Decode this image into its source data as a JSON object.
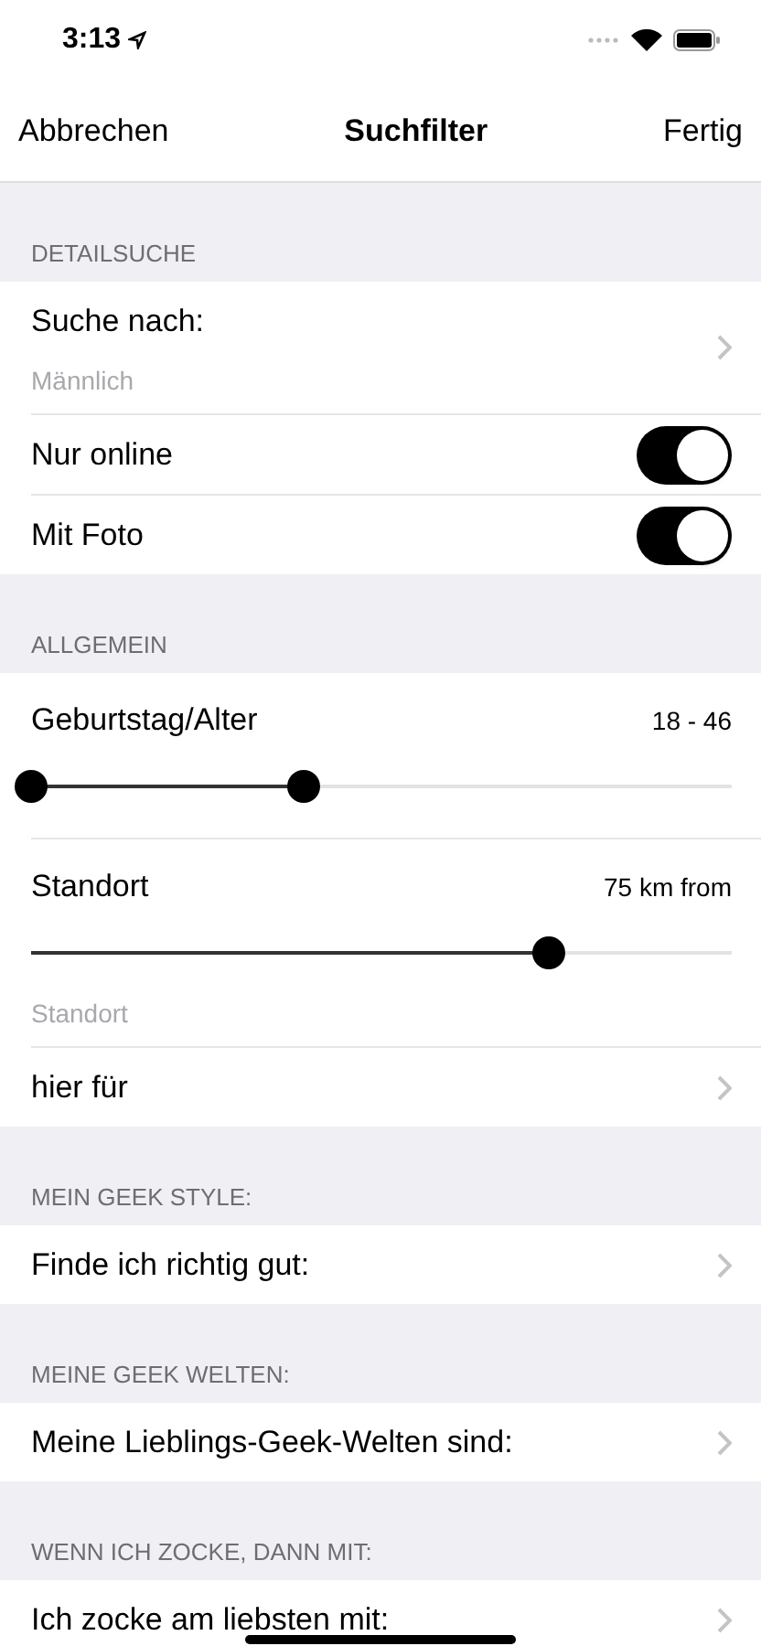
{
  "status_bar": {
    "time": "3:13"
  },
  "nav": {
    "cancel": "Abbrechen",
    "title": "Suchfilter",
    "done": "Fertig"
  },
  "sections": [
    {
      "header": "DETAILSUCHE",
      "rows": [
        {
          "kind": "nav",
          "label": "Suche nach:",
          "subtitle": "Männlich"
        },
        {
          "kind": "toggle",
          "label": "Nur online",
          "on": true
        },
        {
          "kind": "toggle",
          "label": "Mit Foto",
          "on": true
        }
      ]
    },
    {
      "header": "ALLGEMEIN",
      "rows": [
        {
          "kind": "range",
          "label": "Geburtstag/Alter",
          "value": "18 - 46",
          "thumbs": [
            {
              "level": 0
            },
            {
              "level": 0.39
            }
          ]
        },
        {
          "kind": "slider",
          "label": "Standort",
          "value": "75 km from",
          "level": 0.74,
          "caption": "Standort"
        },
        {
          "kind": "nav",
          "label": "hier für"
        }
      ]
    },
    {
      "header": "MEIN GEEK STYLE:",
      "rows": [
        {
          "kind": "nav",
          "label": "Finde ich richtig gut:"
        }
      ]
    },
    {
      "header": "MEINE GEEK WELTEN:",
      "rows": [
        {
          "kind": "nav",
          "label": "Meine Lieblings-Geek-Welten sind:"
        }
      ]
    },
    {
      "header": "WENN ICH ZOCKE, DANN MIT:",
      "rows": [
        {
          "kind": "nav",
          "label": "Ich zocke am liebsten mit:"
        }
      ]
    }
  ]
}
